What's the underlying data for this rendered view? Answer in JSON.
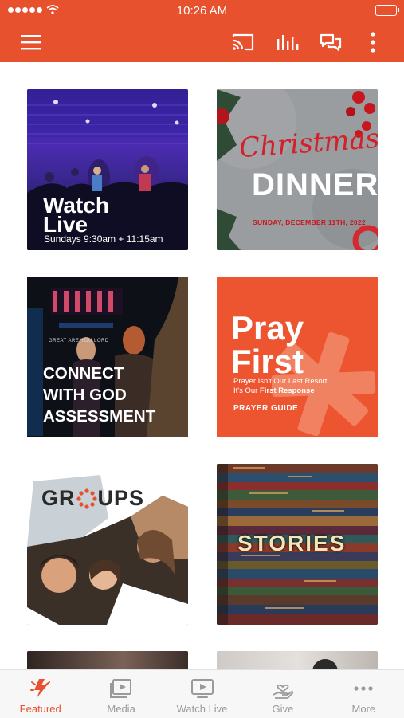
{
  "status_bar": {
    "time": "10:26 AM"
  },
  "toolbar": {
    "icons": [
      "menu-icon",
      "cast-icon",
      "audio-bars-icon",
      "chat-icon",
      "more-vertical-icon"
    ]
  },
  "tiles": [
    {
      "id": "watch-live",
      "title_line1": "Watch",
      "title_line2": "Live",
      "subtitle": "Sundays 9:30am + 11:15am"
    },
    {
      "id": "christmas-dinner",
      "script_text": "Christmas",
      "title": "DINNER",
      "date": "SUNDAY, DECEMBER 11TH, 2022"
    },
    {
      "id": "connect",
      "line1": "CONNECT",
      "line2": "WITH GOD",
      "line3": "ASSESSMENT",
      "banner": "GREAT ARE YOU LORD"
    },
    {
      "id": "pray-first",
      "line1": "Pray",
      "line2": "First",
      "sub1": "Prayer Isn't Our Last Resort,",
      "sub2_pre": "It's Our ",
      "sub2_bold": "First Response",
      "guide": "PRAYER GUIDE"
    },
    {
      "id": "groups",
      "title_pre": "GR",
      "title_post": "UPS"
    },
    {
      "id": "stories",
      "title": "STORIES"
    }
  ],
  "tabbar": {
    "tabs": [
      {
        "label": "Featured",
        "icon": "featured-spark-icon",
        "active": true
      },
      {
        "label": "Media",
        "icon": "media-icon",
        "active": false
      },
      {
        "label": "Watch Live",
        "icon": "watch-live-icon",
        "active": false
      },
      {
        "label": "Give",
        "icon": "give-icon",
        "active": false
      },
      {
        "label": "More",
        "icon": "more-horizontal-icon",
        "active": false
      }
    ]
  },
  "colors": {
    "accent": "#e8512e",
    "tab_inactive": "#9a9a9a",
    "tabbar_bg": "#f7f7f7"
  }
}
